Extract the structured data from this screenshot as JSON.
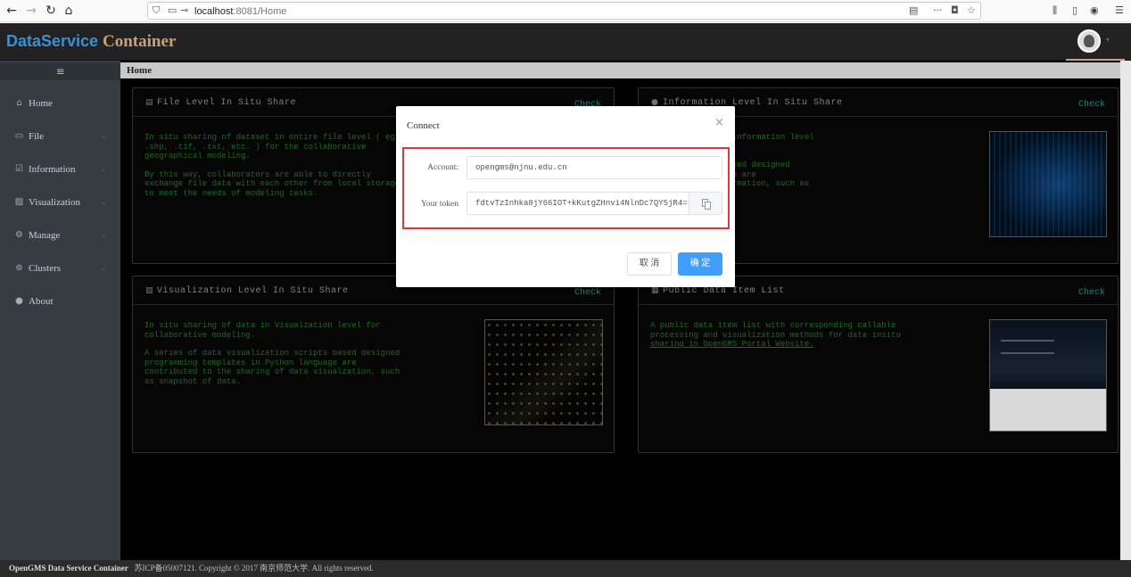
{
  "browser": {
    "url_host": "localhost",
    "url_path": ":8081/Home",
    "back_icon": "back-arrow-icon",
    "forward_icon": "forward-arrow-icon",
    "reload_icon": "reload-icon",
    "home_icon": "home-icon"
  },
  "header": {
    "logo_part1": "DataService",
    "logo_part2": "Container"
  },
  "sidebar": {
    "toggle": "≡",
    "items": [
      {
        "label": "Home",
        "icon": "home-icon"
      },
      {
        "label": "File",
        "icon": "file-icon"
      },
      {
        "label": "Information",
        "icon": "information-icon"
      },
      {
        "label": "Visualization",
        "icon": "image-icon"
      },
      {
        "label": "Manage",
        "icon": "manage-icon"
      },
      {
        "label": "Clusters",
        "icon": "clusters-icon"
      },
      {
        "label": "About",
        "icon": "info-circle-icon"
      }
    ]
  },
  "breadcrumb": "Home",
  "cards": [
    {
      "title": "File Level In Situ Share",
      "check": "Check",
      "lines": [
        "In situ sharing of dataset in entire file level ( eg:",
        ".shp, .tif, .txt, etc. ) for the collaborative",
        "geographical modeling.",
        "",
        "By this way, collaborators are able to directly",
        "exchange file data with each other from local storage",
        "to meet the needs of modeling tasks."
      ]
    },
    {
      "title": "Information Level In Situ Share",
      "check": "Check",
      "lines": [
        "ta in content or information level",
        "ling.",
        "",
        "essing scripts based designed",
        "in Python language are",
        "ring of data information, such as",
        "hole study area."
      ]
    },
    {
      "title": "Visualization Level In Situ Share",
      "check": "Check",
      "lines": [
        "In situ sharing of data in Visualzation level for",
        "collaborative modeling.",
        "",
        "A series of data visualization scripts based designed",
        "programming templates in Python language are",
        "contributed to the sharing of data visualzation, such",
        "as snapshot of data."
      ]
    },
    {
      "title": "Public Data Item List",
      "check": "Check",
      "lines": [
        "A public data item list with corresponding callable",
        "processing and visualization methods for data insitu",
        "sharing in OpenGMS Portal Website."
      ]
    }
  ],
  "dialog": {
    "title": "Connect",
    "account_label": "Account:",
    "account_value": "opengms@njnu.edu.cn",
    "token_label": "Your token",
    "token_value": "fdtvTzInhka8jY66IOT+kKutgZHnvi4NlnDc7QY5jR4=",
    "cancel": "取 消",
    "ok": "确 定"
  },
  "footer": {
    "brand": "OpenGMS Data Service Container",
    "rest": "苏ICP备05007121. Copyright © 2017 南京师范大学. All rights reserved."
  }
}
